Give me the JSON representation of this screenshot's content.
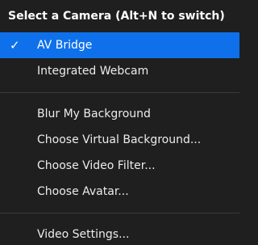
{
  "menu": {
    "header": "Select a Camera (Alt+N to switch)",
    "cameras": [
      {
        "label": "AV Bridge",
        "selected": true
      },
      {
        "label": "Integrated Webcam",
        "selected": false
      }
    ],
    "background_items": [
      {
        "label": "Blur My Background"
      },
      {
        "label": "Choose Virtual Background..."
      },
      {
        "label": "Choose Video Filter..."
      },
      {
        "label": "Choose Avatar..."
      }
    ],
    "settings_items": [
      {
        "label": "Video Settings..."
      }
    ],
    "check_icon": "checkmark-icon",
    "accent_color": "#0e71eb",
    "background_color": "#1f1f1f"
  }
}
